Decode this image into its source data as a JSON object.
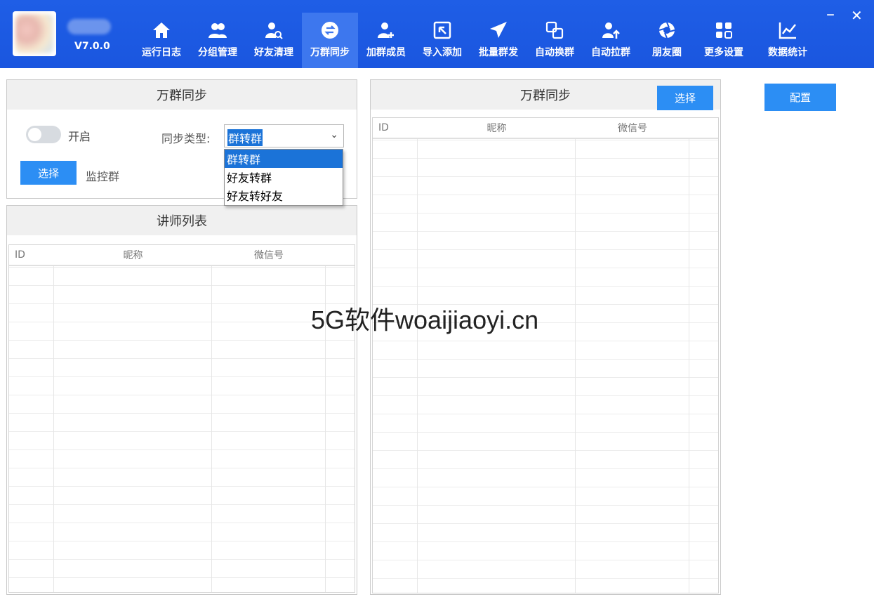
{
  "header": {
    "version": "V7.0.0",
    "nav": [
      {
        "label": "运行日志",
        "icon": "home-icon"
      },
      {
        "label": "分组管理",
        "icon": "users-icon"
      },
      {
        "label": "好友清理",
        "icon": "user-search-icon"
      },
      {
        "label": "万群同步",
        "icon": "sync-icon",
        "active": true
      },
      {
        "label": "加群成员",
        "icon": "user-add-icon"
      },
      {
        "label": "导入添加",
        "icon": "import-icon"
      },
      {
        "label": "批量群发",
        "icon": "send-icon"
      },
      {
        "label": "自动换群",
        "icon": "swap-icon"
      },
      {
        "label": "自动拉群",
        "icon": "pull-user-icon"
      },
      {
        "label": "朋友圈",
        "icon": "aperture-icon"
      },
      {
        "label": "更多设置",
        "icon": "grid-icon"
      },
      {
        "label": "数据统计",
        "icon": "chart-icon"
      }
    ],
    "minimize": "–",
    "close": "✕"
  },
  "sync_panel": {
    "title": "万群同步",
    "toggle_label": "开启",
    "sync_type_label": "同步类型:",
    "sync_type_value": "群转群",
    "select_button": "选择",
    "monitor_label": "监控群",
    "options": [
      "群转群",
      "好友转群",
      "好友转好友"
    ]
  },
  "teacher_panel": {
    "title": "讲师列表",
    "columns": [
      "ID",
      "昵称",
      "微信号"
    ]
  },
  "right_panel": {
    "title": "万群同步",
    "select_button": "选择",
    "columns": [
      "ID",
      "昵称",
      "微信号"
    ]
  },
  "config_button": "配置",
  "watermark": "5G软件woaijiaoyi.cn",
  "colors": {
    "header_bg": "#1a56df",
    "active_tab": "#3d77ee",
    "button": "#2c8ef4",
    "selection": "#1b73d8"
  }
}
